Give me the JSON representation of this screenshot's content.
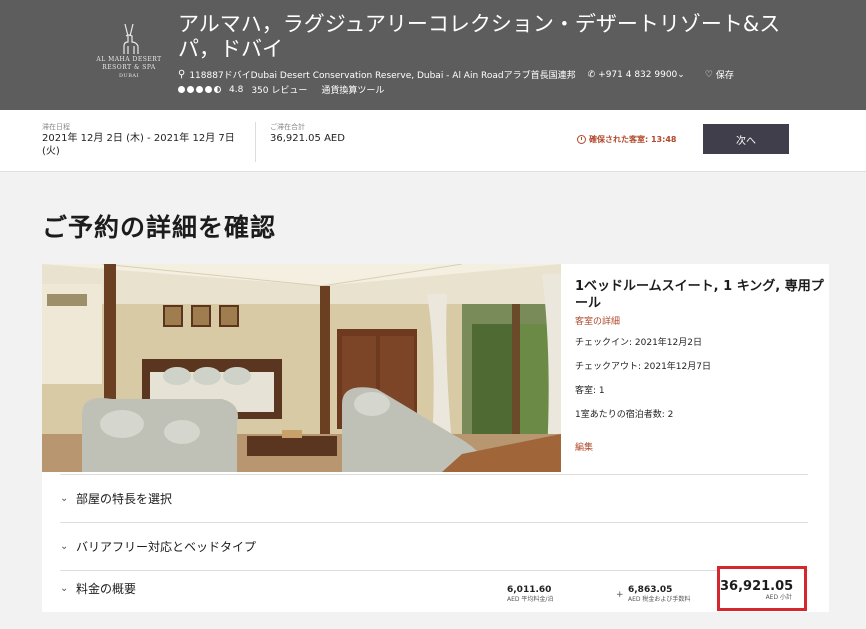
{
  "header": {
    "logo": {
      "line1": "AL MAHA DESERT",
      "line2": "RESORT & SPA",
      "line3": "DUBAI"
    },
    "title": "アルマハ，ラグジュアリーコレクション・デザートリゾート&スパ，ドバイ",
    "address": "118887ドバイDubai Desert Conservation Reserve, Dubai - Al Ain Roadアラブ首長国連邦",
    "phone": "+971 4 832 9900",
    "save_label": "保存",
    "rating_score": "4.8",
    "rating_value": 4.5,
    "reviews": "350 レビュー",
    "currency_tool": "通貨換算ツール"
  },
  "stay": {
    "dates_label": "滞在日程",
    "dates_value": "2021年 12月 2日 (木) - 2021年 12月 7日 (火)",
    "total_label": "ご滞在合計",
    "total_value": "36,921.05 AED",
    "held_label": "確保された客室: 13:48",
    "next_button": "次へ"
  },
  "page": {
    "title": "ご予約の詳細を確認"
  },
  "room": {
    "name": "1ベッドルームスイート, 1 キング, 専用プール",
    "details_link": "客室の詳細",
    "checkin": "チェックイン: 2021年12月2日",
    "checkout": "チェックアウト: 2021年12月7日",
    "rooms": "客室: 1",
    "guests": "1室あたりの宿泊者数: 2",
    "edit_link": "編集"
  },
  "sections": {
    "features": "部屋の特長を選択",
    "accessibility": "バリアフリー対応とベッドタイプ",
    "rate_summary": "料金の概要"
  },
  "pricing": {
    "avg_rate": "6,011.60",
    "avg_rate_label": "AED 平均料金/泊",
    "plus": "+",
    "taxes": "6,863.05",
    "taxes_label": "AED 税金および手数料",
    "subtotal": "36,921.05",
    "subtotal_label": "AED 小計"
  },
  "colors": {
    "header_bg": "#5d5d5d",
    "accent": "#b0482a",
    "button_bg": "#3f3e4a",
    "highlight_border": "#d6262e"
  }
}
